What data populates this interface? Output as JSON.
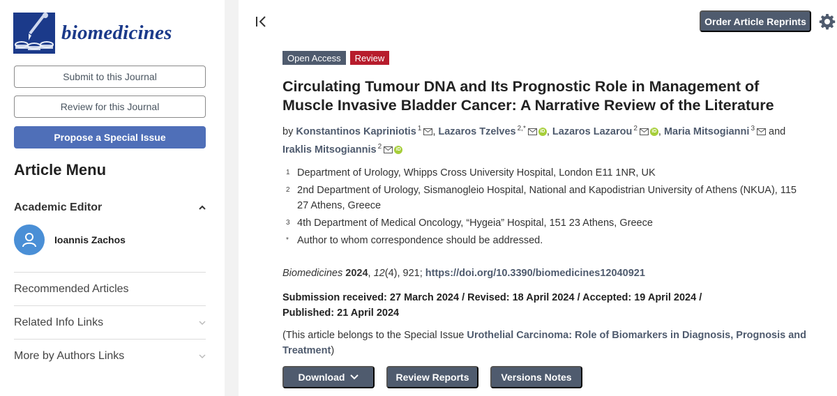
{
  "journal": {
    "name": "biomedicines"
  },
  "sidebar": {
    "submit_label": "Submit to this Journal",
    "review_label": "Review for this Journal",
    "propose_label": "Propose a Special Issue",
    "menu_title": "Article Menu",
    "academic_editor_label": "Academic Editor",
    "editor_name": "Ioannis Zachos",
    "links": [
      "Recommended Articles",
      "Related Info Links",
      "More by Authors Links"
    ]
  },
  "toolbar": {
    "order_label": "Order Article Reprints"
  },
  "article": {
    "badges": [
      "Open Access",
      "Review"
    ],
    "title": "Circulating Tumour DNA and Its Prognostic Role in Management of Muscle Invasive Bladder Cancer: A Narrative Review of the Literature",
    "by": "by",
    "and": "and",
    "authors": [
      {
        "name": "Konstantinos Kapriniotis",
        "sup": "1"
      },
      {
        "name": "Lazaros Tzelves",
        "sup": "2,*"
      },
      {
        "name": "Lazaros Lazarou",
        "sup": "2"
      },
      {
        "name": "Maria Mitsogianni",
        "sup": "3"
      },
      {
        "name": "Iraklis Mitsogiannis",
        "sup": "2"
      }
    ],
    "affiliations": [
      {
        "num": "1",
        "text": "Department of Urology, Whipps Cross University Hospital, London E11 1NR, UK"
      },
      {
        "num": "2",
        "text": "2nd Department of Urology, Sismanogleio Hospital, National and Kapodistrian University of Athens (NKUA), 115 27 Athens, Greece"
      },
      {
        "num": "3",
        "text": "4th Department of Medical Oncology, “Hygeia” Hospital, 151 23 Athens, Greece"
      },
      {
        "num": "*",
        "text": "Author to whom correspondence should be addressed."
      }
    ],
    "citation": {
      "journal": "Biomedicines",
      "year": "2024",
      "volume": "12",
      "issue_pages": "(4), 921; ",
      "doi": "https://doi.org/10.3390/biomedicines12040921"
    },
    "dates_line1": "Submission received: 27 March 2024 / Revised: 18 April 2024 / Accepted: 19 April 2024 /",
    "dates_line2": "Published: 21 April 2024",
    "special_prefix": "(This article belongs to the Special Issue ",
    "special_issue": "Urothelial Carcinoma: Role of Biomarkers in Diagnosis, Prognosis and Treatment",
    "special_suffix": ")"
  },
  "actions": {
    "download_label": "Download",
    "review_reports_label": "Review Reports",
    "versions_label": "Versions Notes"
  },
  "colors": {
    "accent": "#4f5b6e",
    "brand": "#1b3a8a",
    "review_badge": "#b71c2c",
    "propose_button": "#4f6fb8",
    "orcid": "#a6ce39"
  },
  "icons": [
    "collapse-sidebar-icon",
    "gear-icon",
    "mail-icon",
    "orcid-icon",
    "chevron-up-icon",
    "chevron-down-icon",
    "user-icon"
  ]
}
